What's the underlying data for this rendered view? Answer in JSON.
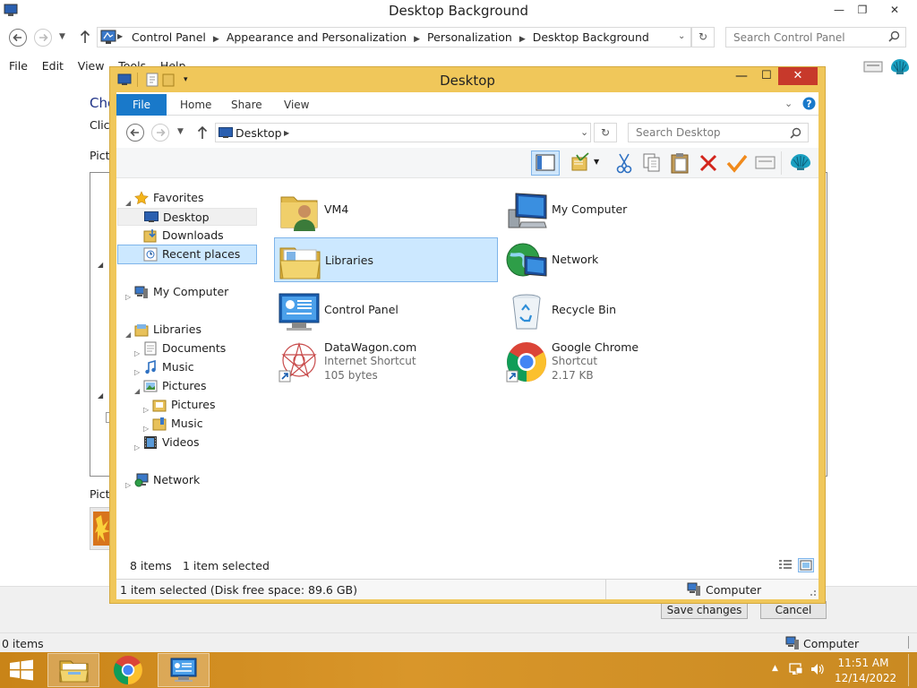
{
  "background_window": {
    "title": "Desktop Background",
    "breadcrumbs": [
      "Control Panel",
      "Appearance and Personalization",
      "Personalization",
      "Desktop Background"
    ],
    "search_placeholder": "Search Control Panel",
    "menu": [
      "File",
      "Edit",
      "View",
      "Tools",
      "Help"
    ],
    "partial_heading": "Cho",
    "partial_instruction": "Clic",
    "partial_picture_location": "Pictu",
    "partial_picture_position": "Pictu",
    "save_label": "Save changes",
    "cancel_label": "Cancel",
    "status_count": "0 items",
    "status_computer": "Computer"
  },
  "explorer": {
    "title": "Desktop",
    "ribbon_tabs": [
      "File",
      "Home",
      "Share",
      "View"
    ],
    "address": "Desktop",
    "search_placeholder": "Search Desktop",
    "nav": {
      "favorites": "Favorites",
      "desktop": "Desktop",
      "downloads": "Downloads",
      "recent": "Recent places",
      "my_computer": "My Computer",
      "libraries": "Libraries",
      "documents": "Documents",
      "music": "Music",
      "pictures": "Pictures",
      "pictures_sub": "Pictures",
      "music_sub": "Music",
      "videos": "Videos",
      "network": "Network"
    },
    "items": [
      {
        "name": "VM4",
        "icon": "user-folder-icon"
      },
      {
        "name": "My Computer",
        "icon": "computer-icon"
      },
      {
        "name": "Libraries",
        "icon": "libraries-folder-icon",
        "selected": true
      },
      {
        "name": "Network",
        "icon": "network-globe-icon"
      },
      {
        "name": "Control Panel",
        "icon": "control-panel-icon"
      },
      {
        "name": "Recycle Bin",
        "icon": "recycle-bin-icon"
      },
      {
        "name": "DataWagon.com",
        "type": "Internet Shortcut",
        "size": "105 bytes",
        "icon": "datawagon-icon"
      },
      {
        "name": "Google Chrome",
        "type": "Shortcut",
        "size": "2.17 KB",
        "icon": "chrome-icon"
      }
    ],
    "status_count": "8 items",
    "status_selected": "1 item selected",
    "bottom_status": "1 item selected (Disk free space: 89.6 GB)",
    "bottom_computer": "Computer"
  },
  "taskbar": {
    "time": "11:51 AM",
    "date": "12/14/2022",
    "buttons": [
      "start-button",
      "file-explorer",
      "google-chrome",
      "control-panel"
    ]
  },
  "colors": {
    "accent_frame": "#f0c75a",
    "taskbar": "#d9962a",
    "selection": "#cce8ff",
    "file_tab": "#1979ca",
    "close_red": "#c7392b"
  }
}
